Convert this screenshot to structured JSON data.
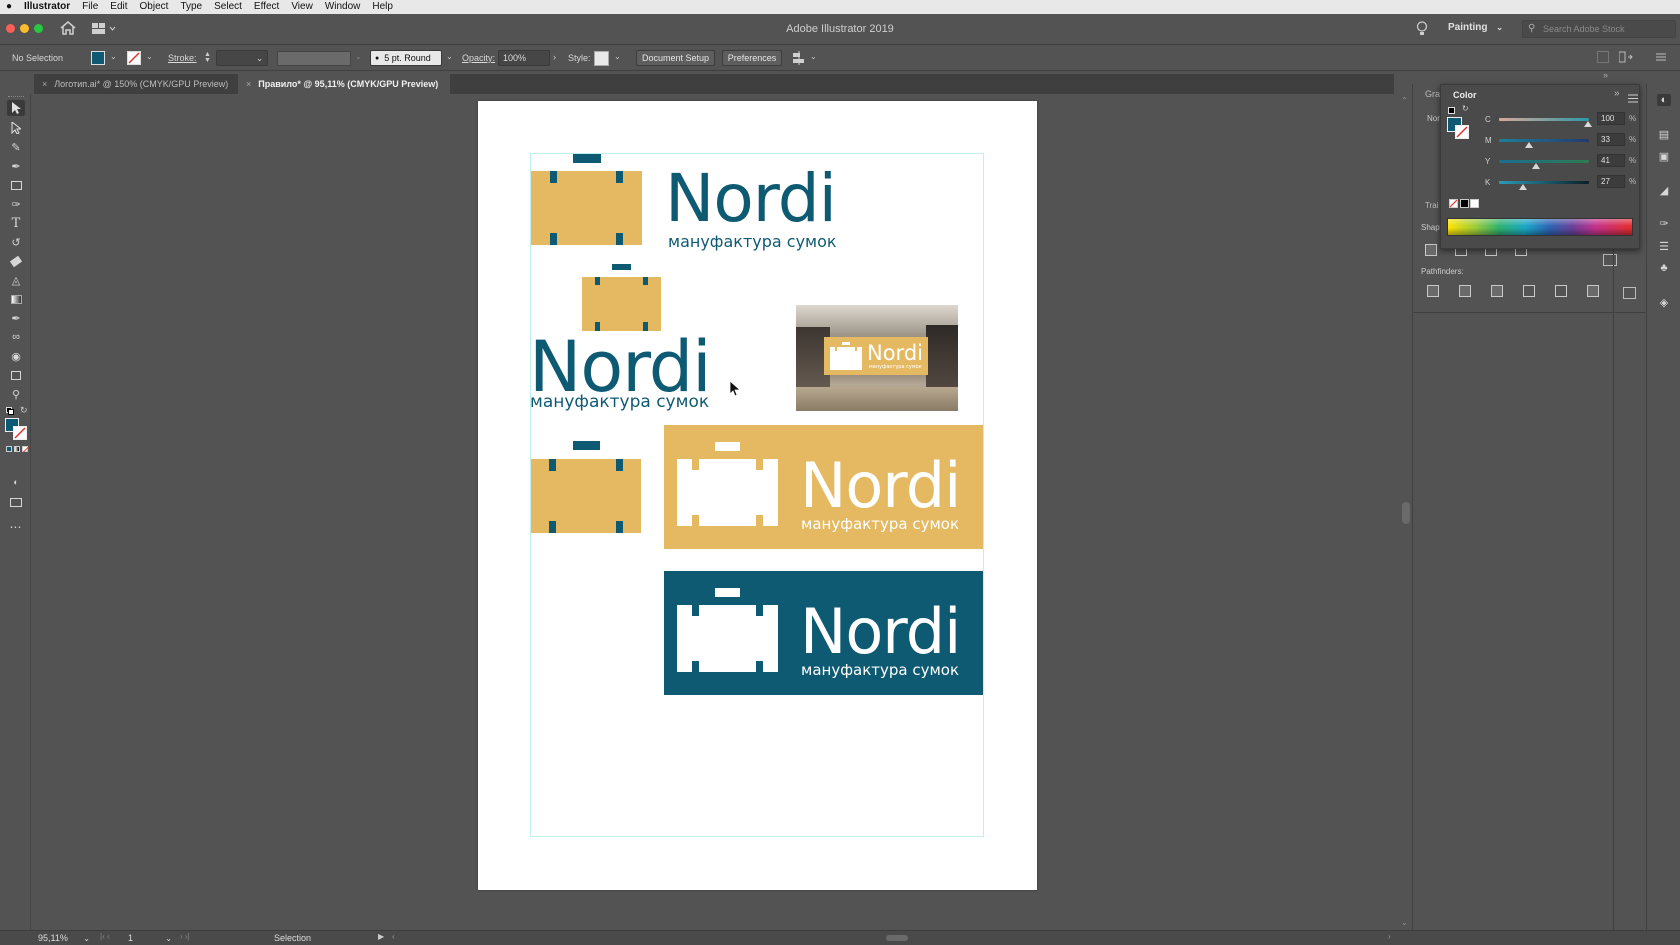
{
  "menubar": {
    "apple": "",
    "items": [
      "Illustrator",
      "File",
      "Edit",
      "Object",
      "Type",
      "Select",
      "Effect",
      "View",
      "Window",
      "Help"
    ]
  },
  "window": {
    "title": "Adobe Illustrator 2019",
    "workspace": "Painting",
    "search_placeholder": "Search Adobe Stock"
  },
  "controlbar": {
    "selection": "No Selection",
    "stroke_label": "Stroke:",
    "brush": "5 pt. Round",
    "opacity_label": "Opacity:",
    "opacity_value": "100%",
    "style_label": "Style:",
    "document_setup": "Document Setup",
    "preferences": "Preferences"
  },
  "tabs": [
    {
      "label": "Логотип.ai* @ 150% (CMYK/GPU Preview)",
      "active": false
    },
    {
      "label": "Правило* @ 95,11% (CMYK/GPU Preview)",
      "active": true
    }
  ],
  "artwork": {
    "brand": "Nordi",
    "tagline": "мануфактура сумок",
    "colors": {
      "teal": "#0e5a73",
      "gold": "#e5b962",
      "white": "#ffffff"
    }
  },
  "color_panel": {
    "gradient_tab": "Grac",
    "color_tab": "Color",
    "channels": [
      {
        "name": "C",
        "value": "100"
      },
      {
        "name": "M",
        "value": "33"
      },
      {
        "name": "Y",
        "value": "41"
      },
      {
        "name": "K",
        "value": "27"
      }
    ],
    "percent": "%"
  },
  "right_panel": {
    "nor_label": "Nor",
    "transform_label": "Trai",
    "shape_label": "Shap",
    "pathfinders_label": "Pathfinders:"
  },
  "status": {
    "zoom": "95,11%",
    "artboard": "1",
    "tool": "Selection"
  }
}
